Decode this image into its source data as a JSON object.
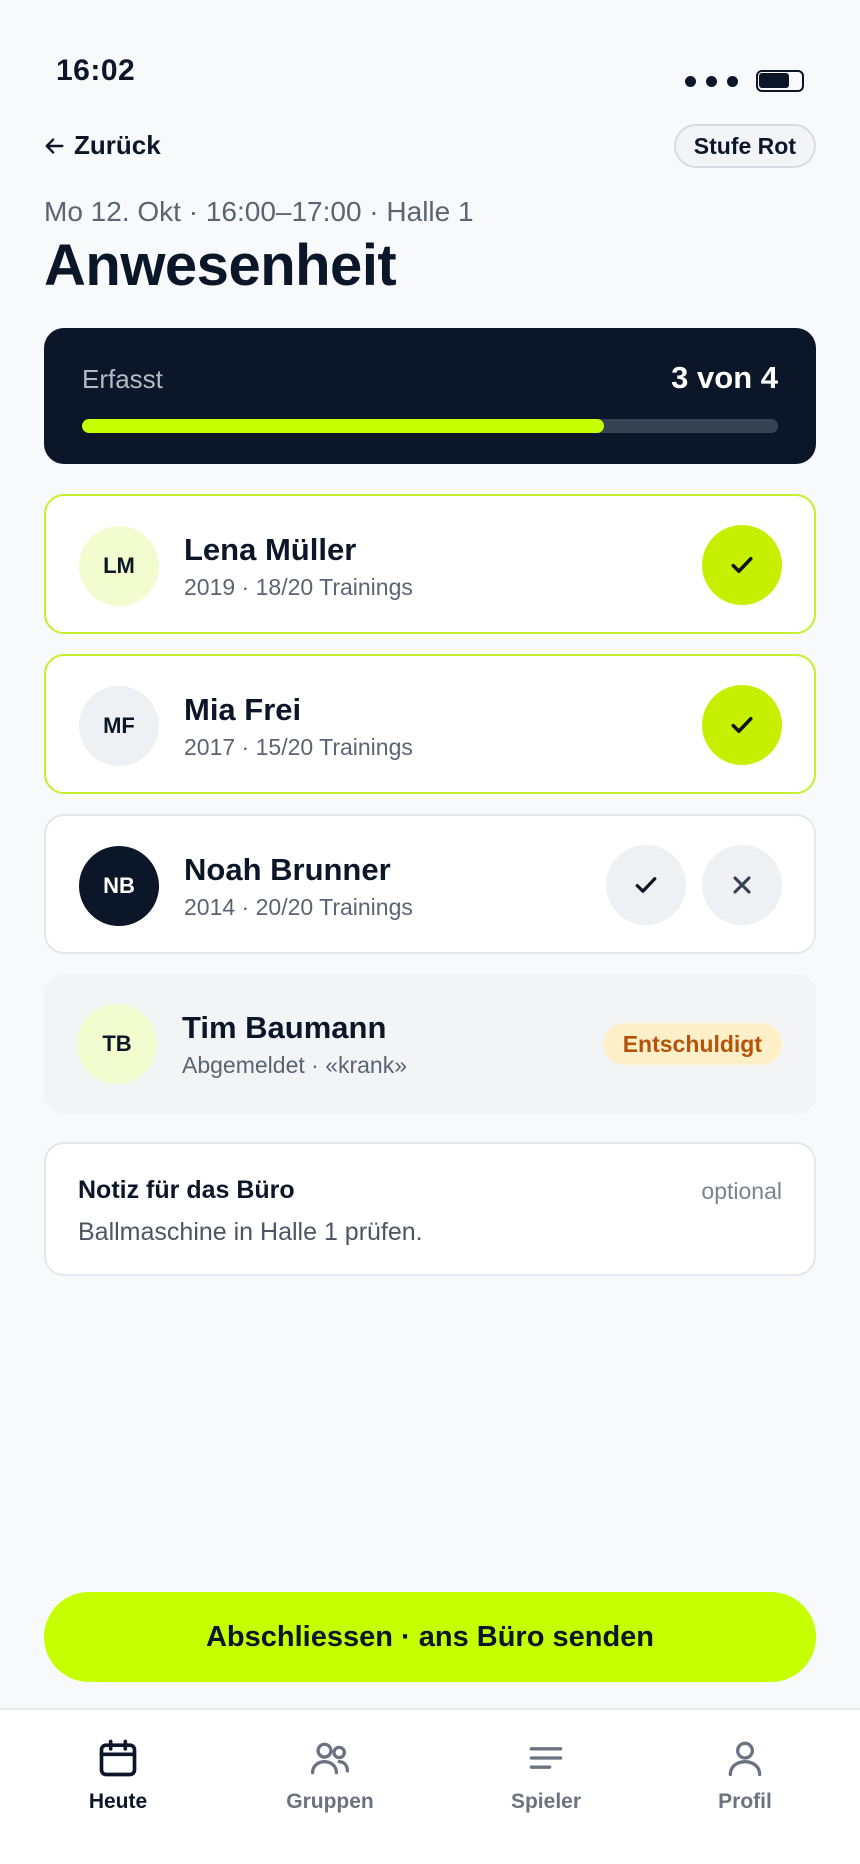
{
  "status_bar": {
    "time": "16:02"
  },
  "header": {
    "back_label": "Zurück",
    "level_label": "Stufe Rot",
    "subtitle": "Mo 12. Okt · 16:00–17:00 · Halle 1",
    "title": "Anwesenheit"
  },
  "progress": {
    "label": "Erfasst",
    "count_text": "3 von 4",
    "recorded": 3,
    "total": 4
  },
  "players": [
    {
      "initials": "LM",
      "name": "Lena Müller",
      "meta": "2019 · 18/20 Trainings",
      "status": "present"
    },
    {
      "initials": "MF",
      "name": "Mia Frei",
      "meta": "2017 · 15/20 Trainings",
      "status": "present"
    },
    {
      "initials": "NB",
      "name": "Noah Brunner",
      "meta": "2014 · 20/20 Trainings",
      "status": "open"
    },
    {
      "initials": "TB",
      "name": "Tim Baumann",
      "meta": "Abgemeldet · «krank»",
      "status": "excused",
      "badge": "Entschuldigt"
    }
  ],
  "note": {
    "title": "Notiz für das Büro",
    "optional_label": "optional",
    "text": "Ballmaschine in Halle 1 prüfen."
  },
  "submit": {
    "label": "Abschliessen · ans Büro senden"
  },
  "tabs": [
    {
      "label": "Heute",
      "icon": "calendar-icon",
      "active": true
    },
    {
      "label": "Gruppen",
      "icon": "users-icon",
      "active": false
    },
    {
      "label": "Spieler",
      "icon": "list-icon",
      "active": false
    },
    {
      "label": "Profil",
      "icon": "user-icon",
      "active": false
    }
  ],
  "colors": {
    "accent": "#c6ff00",
    "dark": "#0b1628",
    "badge_bg": "#fdf0c8",
    "badge_text": "#b45309"
  }
}
